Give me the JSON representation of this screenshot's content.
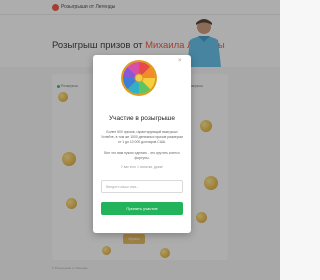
{
  "header": {
    "brand": "Розыгрыши от Легенды"
  },
  "page": {
    "title_prefix": "Розыгрыш призов от ",
    "title_highlight": "Михаила Легенды",
    "tags": [
      "Розыгрыш",
      "Розыгрыш",
      "Розыгрыш",
      "Розыгрыш"
    ],
    "bg_button": "Играть",
    "footer": "© Розыгрыши от Легенды"
  },
  "modal": {
    "title": "Участие в розыгрыше",
    "description": "Более 500 призов, гарантирующий выигрыш! Успейте, в том же 1000 денежных призов размером от 1 до 10 000 долларов США.",
    "note": "Все что вам нужно сделать - это крутить колесо фортуны.",
    "limit": "У вас есть 1 попытка, удачи!",
    "input_placeholder": "Введите ваше имя...",
    "input_value": "",
    "submit_label": "Принять участие"
  },
  "colors": {
    "accent": "#e8442c",
    "primary_button": "#23b35a",
    "coin": "#eab83a"
  }
}
